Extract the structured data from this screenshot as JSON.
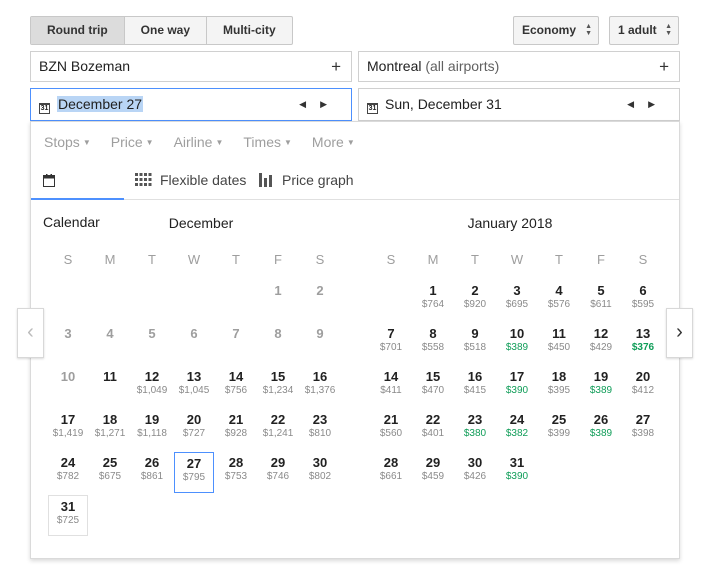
{
  "trip_types": [
    "Round trip",
    "One way",
    "Multi-city"
  ],
  "cabin_class": "Economy",
  "passengers": "1 adult",
  "origin": "BZN Bozeman",
  "destination": {
    "city": "Montreal",
    "suffix": "(all airports)"
  },
  "depart_date": "December 27",
  "return_date": "Sun, December 31",
  "calendar_icon_text": "31",
  "filters": [
    "Stops",
    "Price",
    "Airline",
    "Times",
    "More"
  ],
  "views": [
    "Calendar",
    "Flexible dates",
    "Price graph"
  ],
  "weekdays": [
    "S",
    "M",
    "T",
    "W",
    "T",
    "F",
    "S"
  ],
  "months": [
    {
      "title": "December",
      "days": [
        {
          "d": "1",
          "p": "",
          "past": true
        },
        {
          "d": "2",
          "p": "",
          "past": true
        },
        {
          "d": "3",
          "p": "",
          "past": true
        },
        {
          "d": "4",
          "p": "",
          "past": true
        },
        {
          "d": "5",
          "p": "",
          "past": true
        },
        {
          "d": "6",
          "p": "",
          "past": true
        },
        {
          "d": "7",
          "p": "",
          "past": true
        },
        {
          "d": "8",
          "p": "",
          "past": true
        },
        {
          "d": "9",
          "p": "",
          "past": true
        },
        {
          "d": "10",
          "p": "",
          "past": true
        },
        {
          "d": "11",
          "p": ""
        },
        {
          "d": "12",
          "p": "$1,049"
        },
        {
          "d": "13",
          "p": "$1,045"
        },
        {
          "d": "14",
          "p": "$756"
        },
        {
          "d": "15",
          "p": "$1,234"
        },
        {
          "d": "16",
          "p": "$1,376"
        },
        {
          "d": "17",
          "p": "$1,419"
        },
        {
          "d": "18",
          "p": "$1,271"
        },
        {
          "d": "19",
          "p": "$1,118"
        },
        {
          "d": "20",
          "p": "$727"
        },
        {
          "d": "21",
          "p": "$928"
        },
        {
          "d": "22",
          "p": "$1,241"
        },
        {
          "d": "23",
          "p": "$810"
        },
        {
          "d": "24",
          "p": "$782"
        },
        {
          "d": "25",
          "p": "$675"
        },
        {
          "d": "26",
          "p": "$861"
        },
        {
          "d": "27",
          "p": "$795"
        },
        {
          "d": "28",
          "p": "$753"
        },
        {
          "d": "29",
          "p": "$746"
        },
        {
          "d": "30",
          "p": "$802"
        },
        {
          "d": "31",
          "p": "$725"
        }
      ]
    },
    {
      "title": "January 2018",
      "days": [
        {
          "d": "1",
          "p": "$764"
        },
        {
          "d": "2",
          "p": "$920"
        },
        {
          "d": "3",
          "p": "$695"
        },
        {
          "d": "4",
          "p": "$576"
        },
        {
          "d": "5",
          "p": "$611"
        },
        {
          "d": "6",
          "p": "$595"
        },
        {
          "d": "7",
          "p": "$701"
        },
        {
          "d": "8",
          "p": "$558"
        },
        {
          "d": "9",
          "p": "$518"
        },
        {
          "d": "10",
          "p": "$389",
          "low": true
        },
        {
          "d": "11",
          "p": "$450"
        },
        {
          "d": "12",
          "p": "$429"
        },
        {
          "d": "13",
          "p": "$376",
          "lowest": true
        },
        {
          "d": "14",
          "p": "$411"
        },
        {
          "d": "15",
          "p": "$470"
        },
        {
          "d": "16",
          "p": "$415"
        },
        {
          "d": "17",
          "p": "$390",
          "low": true
        },
        {
          "d": "18",
          "p": "$395"
        },
        {
          "d": "19",
          "p": "$389",
          "low": true
        },
        {
          "d": "20",
          "p": "$412"
        },
        {
          "d": "21",
          "p": "$560"
        },
        {
          "d": "22",
          "p": "$401"
        },
        {
          "d": "23",
          "p": "$380",
          "low": true
        },
        {
          "d": "24",
          "p": "$382",
          "low": true
        },
        {
          "d": "25",
          "p": "$399"
        },
        {
          "d": "26",
          "p": "$389",
          "low": true
        },
        {
          "d": "27",
          "p": "$398"
        },
        {
          "d": "28",
          "p": "$661"
        },
        {
          "d": "29",
          "p": "$459"
        },
        {
          "d": "30",
          "p": "$426"
        },
        {
          "d": "31",
          "p": "$390",
          "low": true
        }
      ]
    }
  ],
  "colors": {
    "accent": "#4d90fe",
    "low_price": "#0f9d58"
  }
}
